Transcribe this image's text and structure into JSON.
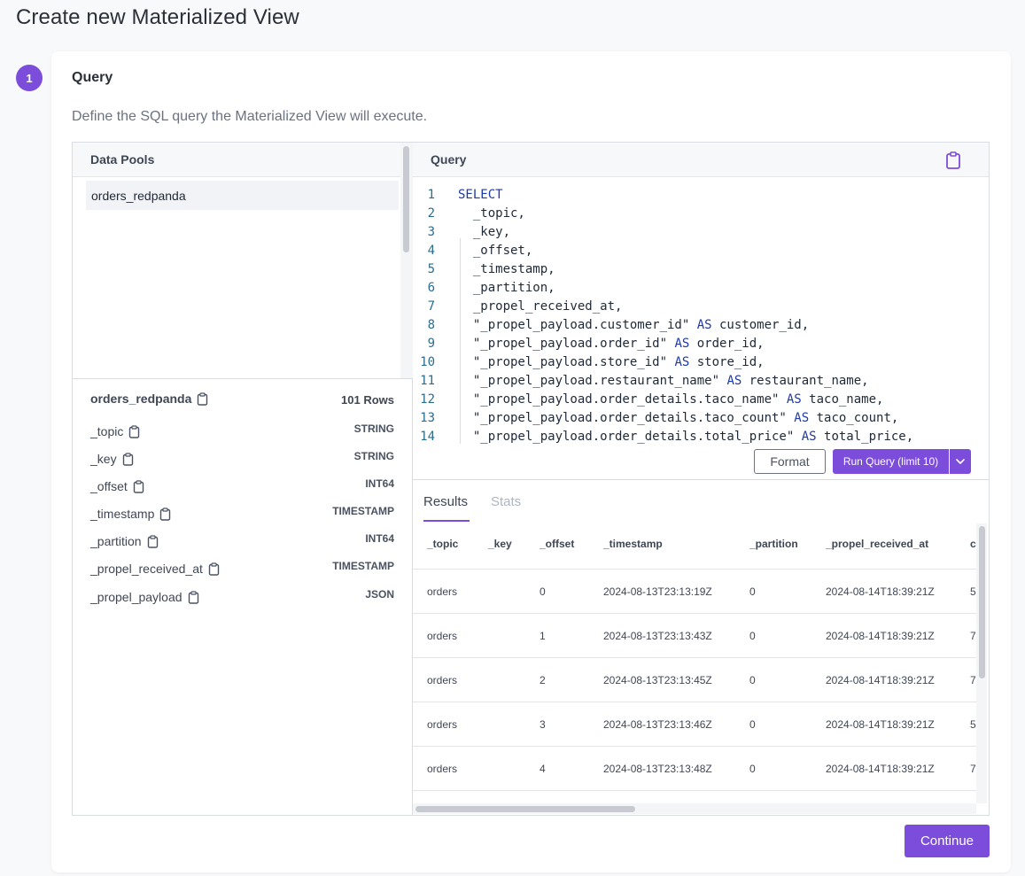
{
  "page": {
    "title": "Create new Materialized View"
  },
  "step": {
    "number": "1",
    "title": "Query",
    "description": "Define the SQL query the Materialized View will execute."
  },
  "data_pools": {
    "header": "Data Pools",
    "items": [
      "orders_redpanda"
    ]
  },
  "schema": {
    "name": "orders_redpanda",
    "row_count": "101 Rows",
    "fields": [
      {
        "name": "_topic",
        "type": "STRING"
      },
      {
        "name": "_key",
        "type": "STRING"
      },
      {
        "name": "_offset",
        "type": "INT64"
      },
      {
        "name": "_timestamp",
        "type": "TIMESTAMP"
      },
      {
        "name": "_partition",
        "type": "INT64"
      },
      {
        "name": "_propel_received_at",
        "type": "TIMESTAMP"
      },
      {
        "name": "_propel_payload",
        "type": "JSON"
      }
    ]
  },
  "query_editor": {
    "header": "Query",
    "lines": [
      {
        "n": "1",
        "pre": "",
        "kw": "SELECT",
        "post": ""
      },
      {
        "n": "2",
        "pre": "  _topic,",
        "kw": "",
        "post": ""
      },
      {
        "n": "3",
        "pre": "  _key,",
        "kw": "",
        "post": ""
      },
      {
        "n": "4",
        "pre": "  _offset,",
        "kw": "",
        "post": ""
      },
      {
        "n": "5",
        "pre": "  _timestamp,",
        "kw": "",
        "post": ""
      },
      {
        "n": "6",
        "pre": "  _partition,",
        "kw": "",
        "post": ""
      },
      {
        "n": "7",
        "pre": "  _propel_received_at,",
        "kw": "",
        "post": ""
      },
      {
        "n": "8",
        "pre": "  \"_propel_payload.customer_id\" ",
        "kw": "AS",
        "post": " customer_id,"
      },
      {
        "n": "9",
        "pre": "  \"_propel_payload.order_id\" ",
        "kw": "AS",
        "post": " order_id,"
      },
      {
        "n": "10",
        "pre": "  \"_propel_payload.store_id\" ",
        "kw": "AS",
        "post": " store_id,"
      },
      {
        "n": "11",
        "pre": "  \"_propel_payload.restaurant_name\" ",
        "kw": "AS",
        "post": " restaurant_name,"
      },
      {
        "n": "12",
        "pre": "  \"_propel_payload.order_details.taco_name\" ",
        "kw": "AS",
        "post": " taco_name,"
      },
      {
        "n": "13",
        "pre": "  \"_propel_payload.order_details.taco_count\" ",
        "kw": "AS",
        "post": " taco_count,"
      },
      {
        "n": "14",
        "pre": "  \"_propel_payload.order_details.total_price\" ",
        "kw": "AS",
        "post": " total_price,"
      }
    ],
    "format_label": "Format",
    "run_label": "Run Query (limit 10)"
  },
  "results": {
    "tabs": [
      "Results",
      "Stats"
    ],
    "active_tab": "Results",
    "columns": [
      "_topic",
      "_key",
      "_offset",
      "_timestamp",
      "_partition",
      "_propel_received_at",
      "c"
    ],
    "rows": [
      [
        "orders",
        "",
        "0",
        "2024-08-13T23:13:19Z",
        "0",
        "2024-08-14T18:39:21Z",
        "5"
      ],
      [
        "orders",
        "",
        "1",
        "2024-08-13T23:13:43Z",
        "0",
        "2024-08-14T18:39:21Z",
        "7"
      ],
      [
        "orders",
        "",
        "2",
        "2024-08-13T23:13:45Z",
        "0",
        "2024-08-14T18:39:21Z",
        "7"
      ],
      [
        "orders",
        "",
        "3",
        "2024-08-13T23:13:46Z",
        "0",
        "2024-08-14T18:39:21Z",
        "5"
      ],
      [
        "orders",
        "",
        "4",
        "2024-08-13T23:13:48Z",
        "0",
        "2024-08-14T18:39:21Z",
        "7"
      ]
    ]
  },
  "footer": {
    "continue_label": "Continue"
  },
  "colors": {
    "accent": "#7c4ddb",
    "keyword": "#1e3aa8",
    "line_number": "#2a6d8f"
  },
  "icons": {
    "copy": "clipboard-icon",
    "dropdown": "chevron-down-icon"
  }
}
